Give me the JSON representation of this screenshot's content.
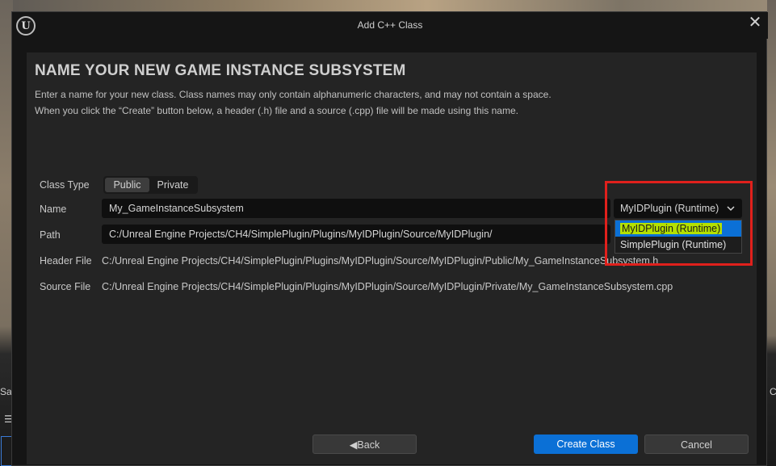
{
  "background": {
    "left_text_1": "Sa",
    "left_text_2": "☰",
    "right_text": "C"
  },
  "window": {
    "title": "Add C++ Class",
    "close_glyph": "✕"
  },
  "page": {
    "heading": "NAME YOUR NEW GAME INSTANCE SUBSYSTEM",
    "description_line1": "Enter a name for your new class. Class names may only contain alphanumeric characters, and may not contain a space.",
    "description_line2": "When you click the “Create” button below, a header (.h) file and a source (.cpp) file will be made using this name."
  },
  "form": {
    "class_type_label": "Class Type",
    "class_type_options": [
      "Public",
      "Private"
    ],
    "class_type_selected": "Public",
    "name_label": "Name",
    "name_value": "My_GameInstanceSubsystem",
    "path_label": "Path",
    "path_value": "C:/Unreal Engine Projects/CH4/SimplePlugin/Plugins/MyIDPlugin/Source/MyIDPlugin/",
    "header_file_label": "Header File",
    "header_file_value": "C:/Unreal Engine Projects/CH4/SimplePlugin/Plugins/MyIDPlugin/Source/MyIDPlugin/Public/My_GameInstanceSubsystem.h",
    "source_file_label": "Source File",
    "source_file_value": "C:/Unreal Engine Projects/CH4/SimplePlugin/Plugins/MyIDPlugin/Source/MyIDPlugin/Private/My_GameInstanceSubsystem.cpp"
  },
  "module_dropdown": {
    "selected": "MyIDPlugin (Runtime)",
    "options": [
      "MyIDPlugin (Runtime)",
      "SimplePlugin (Runtime)"
    ],
    "highlight_color": "#b4e000",
    "selection_color": "#0b70d6",
    "annotation_color": "#e0201c"
  },
  "buttons": {
    "back": "Back",
    "create": "Create Class",
    "cancel": "Cancel"
  },
  "colors": {
    "accent": "#0b70d6",
    "panel": "#242424",
    "window": "#151515"
  }
}
